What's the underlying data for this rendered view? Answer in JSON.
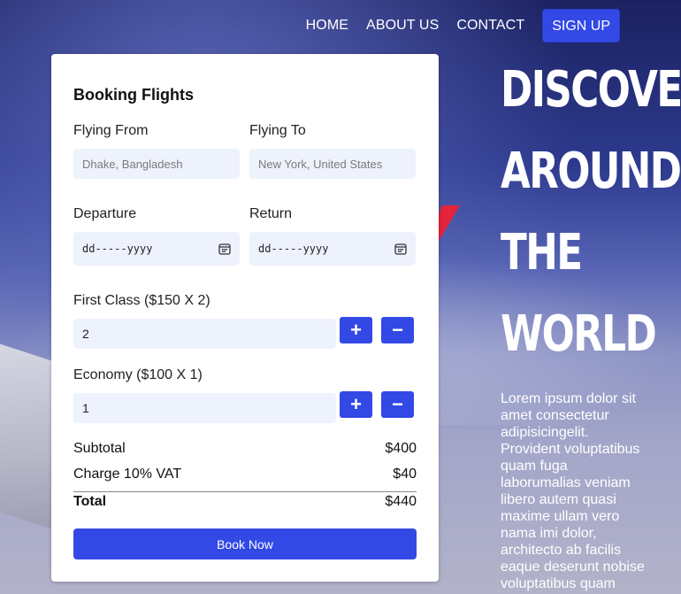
{
  "nav": {
    "links": [
      "HOME",
      "ABOUT US",
      "CONTACT"
    ],
    "signup_label": "SIGN UP"
  },
  "booking": {
    "title": "Booking Flights",
    "from_label": "Flying From",
    "from_placeholder": "Dhake, Bangladesh",
    "to_label": "Flying To",
    "to_placeholder": "New York, United States",
    "departure_label": "Departure",
    "return_label": "Return",
    "date_placeholder": "dd-----yyyy",
    "first_class_label": "First Class ($150 X 2)",
    "first_class_qty": "2",
    "economy_label": "Economy ($100 X 1)",
    "economy_qty": "1",
    "plus": "+",
    "minus": "−",
    "subtotal_label": "Subtotal",
    "subtotal_value": "$400",
    "vat_label": "Charge 10% VAT",
    "vat_value": "$40",
    "total_label": "Total",
    "total_value": "$440",
    "book_label": "Book Now"
  },
  "hero": {
    "title_lines": [
      "DISCOVER",
      "AROUND",
      "THE",
      "WORLD"
    ],
    "text": "Lorem ipsum dolor sit amet consectetur adipisicingelit. Provident voluptatibus quam fuga laborumalias veniam libero autem quasi maxime ullam vero nama imi dolor, architecto ab facilis eaque deserunt nobise voluptatibus quam"
  },
  "colors": {
    "accent": "#3349e6",
    "input_bg": "#eef2fc"
  },
  "icons": {
    "date": "calendar-icon"
  }
}
